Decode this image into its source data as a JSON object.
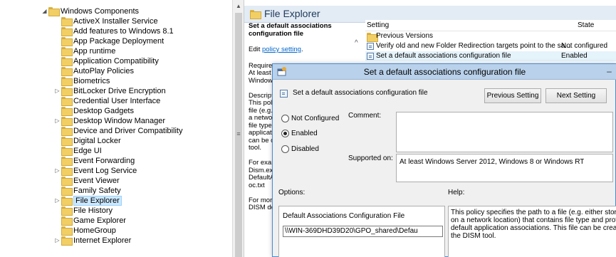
{
  "tree": {
    "items": [
      {
        "label": "Windows Components",
        "expander": "◢"
      },
      {
        "label": "ActiveX Installer Service",
        "expander": ""
      },
      {
        "label": "Add features to Windows 8.1",
        "expander": ""
      },
      {
        "label": "App Package Deployment",
        "expander": ""
      },
      {
        "label": "App runtime",
        "expander": ""
      },
      {
        "label": "Application Compatibility",
        "expander": ""
      },
      {
        "label": "AutoPlay Policies",
        "expander": ""
      },
      {
        "label": "Biometrics",
        "expander": ""
      },
      {
        "label": "BitLocker Drive Encryption",
        "expander": "▷"
      },
      {
        "label": "Credential User Interface",
        "expander": ""
      },
      {
        "label": "Desktop Gadgets",
        "expander": ""
      },
      {
        "label": "Desktop Window Manager",
        "expander": "▷"
      },
      {
        "label": "Device and Driver Compatibility",
        "expander": ""
      },
      {
        "label": "Digital Locker",
        "expander": ""
      },
      {
        "label": "Edge UI",
        "expander": ""
      },
      {
        "label": "Event Forwarding",
        "expander": ""
      },
      {
        "label": "Event Log Service",
        "expander": "▷"
      },
      {
        "label": "Event Viewer",
        "expander": ""
      },
      {
        "label": "Family Safety",
        "expander": ""
      },
      {
        "label": "File Explorer",
        "expander": "▷",
        "selected": true
      },
      {
        "label": "File History",
        "expander": ""
      },
      {
        "label": "Game Explorer",
        "expander": ""
      },
      {
        "label": "HomeGroup",
        "expander": ""
      },
      {
        "label": "Internet Explorer",
        "expander": "▷"
      }
    ],
    "scroll_up": "▲",
    "scroll_grip": "≡"
  },
  "header": {
    "title": "File Explorer"
  },
  "description": {
    "title": "Set a default associations configuration file",
    "edit_prefix": "Edit ",
    "edit_link": "policy setting",
    "edit_suffix": ".",
    "lines": [
      "Require",
      "At least",
      "Window",
      "",
      "Descript",
      "This pol",
      "file (e.g.",
      "a netwo",
      "file type",
      "applicat",
      "can be c",
      "tool.",
      "",
      "For exar",
      "Dism.ex",
      "DefaultA",
      "oc.txt",
      "",
      "For mor",
      "DISM do"
    ]
  },
  "list": {
    "col_setting": "Setting",
    "col_state": "State",
    "collapse_caret": "^",
    "rows": [
      {
        "text": "Previous Versions",
        "state": "",
        "kind": "folder"
      },
      {
        "text": "Verify old and new Folder Redirection targets point to the sa...",
        "state": "Not configured",
        "kind": "policy"
      },
      {
        "text": "Set a default associations configuration file",
        "state": "Enabled",
        "kind": "policy",
        "highlight": true
      }
    ]
  },
  "dialog": {
    "title": "Set a default associations configuration file",
    "min_glyph": "–",
    "heading": "Set a default associations configuration file",
    "prev_button": "Previous Setting",
    "next_button": "Next Setting",
    "radio_not_configured": "Not Configured",
    "radio_enabled": "Enabled",
    "radio_disabled": "Disabled",
    "selected": "enabled",
    "comment_label": "Comment:",
    "supported_label": "Supported on:",
    "supported_value": "At least Windows Server 2012, Windows 8 or Windows RT",
    "options_label": "Options:",
    "help_label": "Help:",
    "option_field_label": "Default Associations Configuration File",
    "option_field_value": "\\\\WIN-369DHD39D20\\GPO_shared\\Defau",
    "help_lines": [
      "This policy specifies the path to a file (e.g. either stored",
      "on a network location) that contains file type and proto",
      "default application associations. This file can be created",
      "the DISM tool."
    ]
  }
}
